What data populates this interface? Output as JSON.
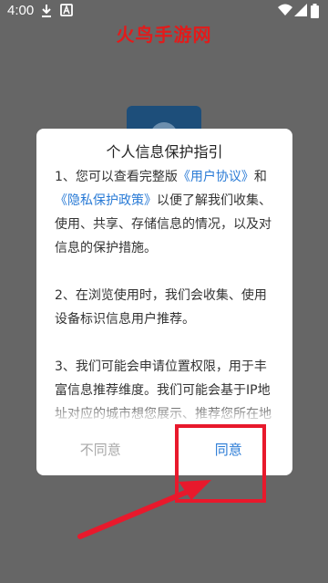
{
  "status_bar": {
    "time": "4:00",
    "left_icons": [
      "download-icon",
      "notification-a-icon"
    ],
    "right_icons": [
      "wifi-icon",
      "signal-icon",
      "battery-icon"
    ]
  },
  "watermark": "火鸟手游网",
  "dialog": {
    "title": "个人信息保护指引",
    "paragraph1": {
      "prefix": "1、您可以查看完整版",
      "link1": "《用户协议》",
      "middle": "和",
      "link2": "《隐私保护政策》",
      "suffix": "以便了解我们收集、使用、共享、存储信息的情况，以及对信息的保护措施。"
    },
    "paragraph2": "2、在浏览使用时，我们会收集、使用设备标识信息用户推荐。",
    "paragraph3": "3、我们可能会申请位置权限，用于丰富信息推荐维度。我们可能会基于IP地址对应的城市想您展示、推荐您所在地区的本地相关信息或内容，城市位置可",
    "disagree_label": "不同意",
    "agree_label": "同意"
  },
  "colors": {
    "overlay": "#666666",
    "link": "#2a7bd6",
    "annotation": "#e8192c",
    "watermark": "#e21b1b"
  }
}
